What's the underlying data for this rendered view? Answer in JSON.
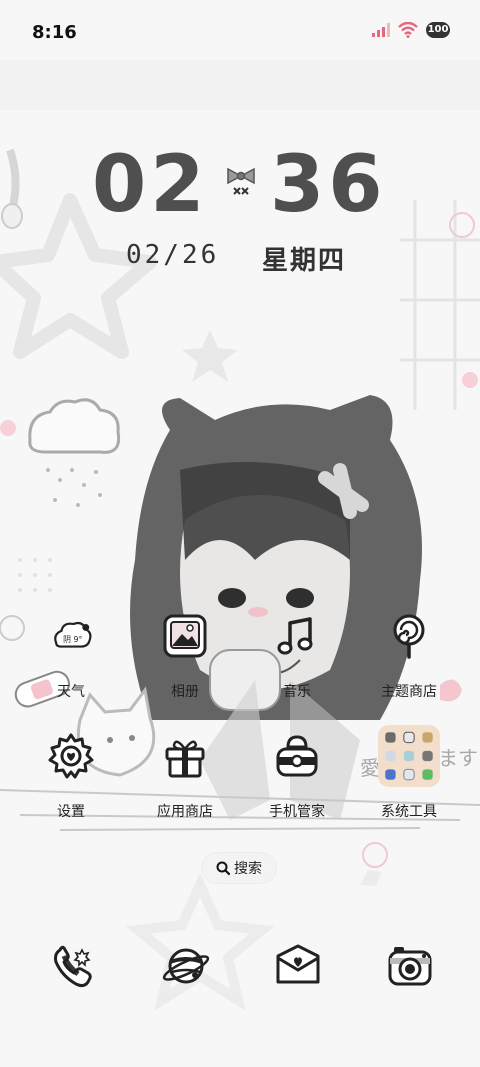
{
  "status_bar": {
    "time": "8:16",
    "battery": "100",
    "icons": [
      "signal-icon",
      "wifi-icon",
      "battery-icon"
    ],
    "accent": "#e7677d"
  },
  "lockclock": {
    "hours": "02",
    "minutes": "36",
    "date": "02/26",
    "weekday": "星期四"
  },
  "weather_widget": {
    "text": "阴 9°"
  },
  "apps": [
    {
      "label": "天气",
      "icon": "cloud-weather-icon"
    },
    {
      "label": "相册",
      "icon": "photo-album-icon"
    },
    {
      "label": "音乐",
      "icon": "music-note-icon"
    },
    {
      "label": "主题商店",
      "icon": "lollipop-icon"
    },
    {
      "label": "设置",
      "icon": "gear-icon"
    },
    {
      "label": "应用商店",
      "icon": "gift-box-icon"
    },
    {
      "label": "手机管家",
      "icon": "security-manager-icon"
    },
    {
      "label": "系统工具",
      "icon": "folder-icon"
    }
  ],
  "search": {
    "label": "搜索",
    "icon": "search-icon"
  },
  "dock": [
    {
      "icon": "phone-icon"
    },
    {
      "icon": "browser-planet-icon"
    },
    {
      "icon": "message-envelope-icon"
    },
    {
      "icon": "camera-icon"
    }
  ],
  "wallpaper": {
    "sticker_text": "愛 ます"
  }
}
